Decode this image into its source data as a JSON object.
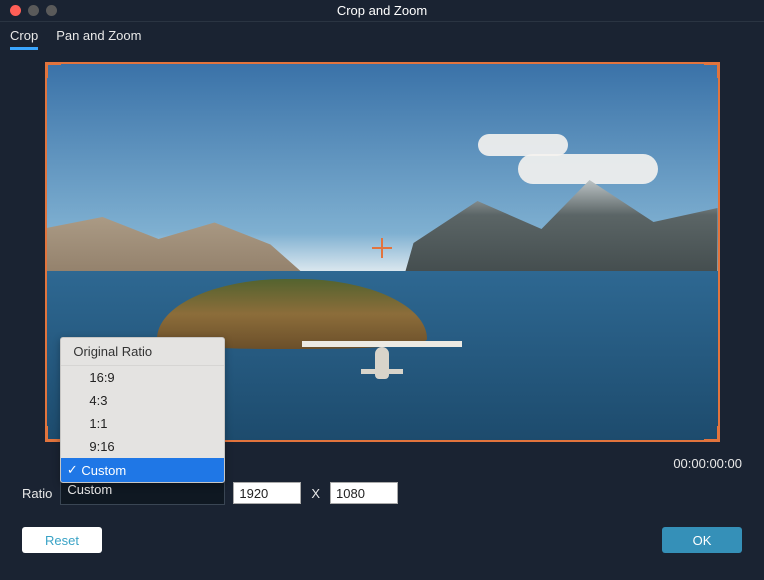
{
  "window": {
    "title": "Crop and Zoom"
  },
  "tabs": {
    "crop": "Crop",
    "pan_and_zoom": "Pan and Zoom",
    "active": "crop"
  },
  "timecode": "00:00:00:00",
  "ratio_label": "Ratio",
  "ratio_menu": {
    "header": "Original Ratio",
    "options": [
      "16:9",
      "4:3",
      "1:1",
      "9:16",
      "Custom"
    ],
    "selected": "Custom"
  },
  "dimensions": {
    "width": "1920",
    "sep": "X",
    "height": "1080"
  },
  "buttons": {
    "reset": "Reset",
    "ok": "OK"
  },
  "icons": {
    "close": "close-icon",
    "minimize": "minimize-icon",
    "zoom": "zoom-icon",
    "check": "✓"
  },
  "colors": {
    "accent_orange": "#e2743d",
    "accent_blue": "#1f77e6",
    "ok_btn": "#3590b8"
  }
}
